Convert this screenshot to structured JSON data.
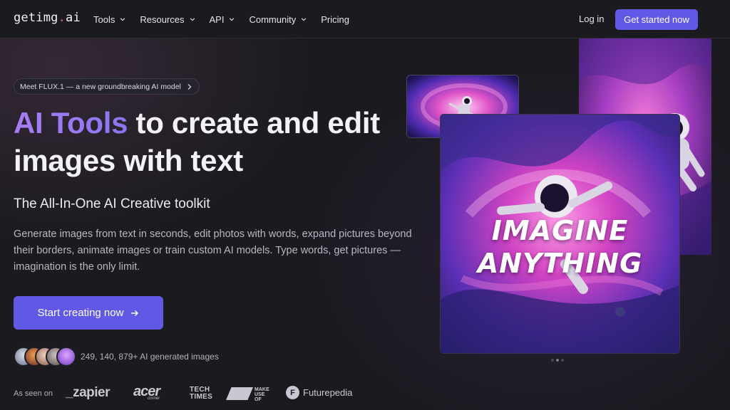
{
  "nav": {
    "logo_main": "getimg",
    "logo_dot": ".",
    "logo_tld": "ai",
    "links": [
      {
        "label": "Tools",
        "dropdown": true
      },
      {
        "label": "Resources",
        "dropdown": true
      },
      {
        "label": "API",
        "dropdown": true
      },
      {
        "label": "Community",
        "dropdown": true
      },
      {
        "label": "Pricing",
        "dropdown": false
      }
    ],
    "login_label": "Log in",
    "cta_label": "Get started now"
  },
  "hero": {
    "pill_text": "Meet FLUX.1 — a new groundbreaking AI model",
    "headline_accent": "AI Tools",
    "headline_rest_1": " to create and edit",
    "headline_rest_2": "images with text",
    "subheadline": "The All-In-One AI Creative toolkit",
    "description": "Generate images from text in seconds, edit photos with words, expand pictures beyond their borders, animate images or train custom AI models. Type words, get pictures — imagination is the only limit.",
    "cta_label": "Start creating now",
    "stat_text": "249, 140, 879+ AI generated images"
  },
  "showcase": {
    "main_image_text_line1": "IMAGINE",
    "main_image_text_line2": "ANYTHING",
    "carousel_dots": 3,
    "active_dot": 1
  },
  "press": {
    "label": "As seen on",
    "brands": {
      "zapier": "_zapier",
      "acer": "acer",
      "acer_sub": "corner",
      "techtimes_1": "TECH",
      "techtimes_2": "TIMES",
      "muo_1": "MAKE",
      "muo_2": "USE",
      "muo_3": "OF",
      "futurepedia_icon": "F",
      "futurepedia": "Futurepedia"
    }
  },
  "colors": {
    "accent": "#6159e6",
    "headline_accent": "#9a7af4",
    "background": "#1b1a1f"
  },
  "icons": [
    "chevron-down-icon",
    "chevron-right-icon",
    "arrow-right-icon",
    "futurepedia-logo-icon"
  ]
}
